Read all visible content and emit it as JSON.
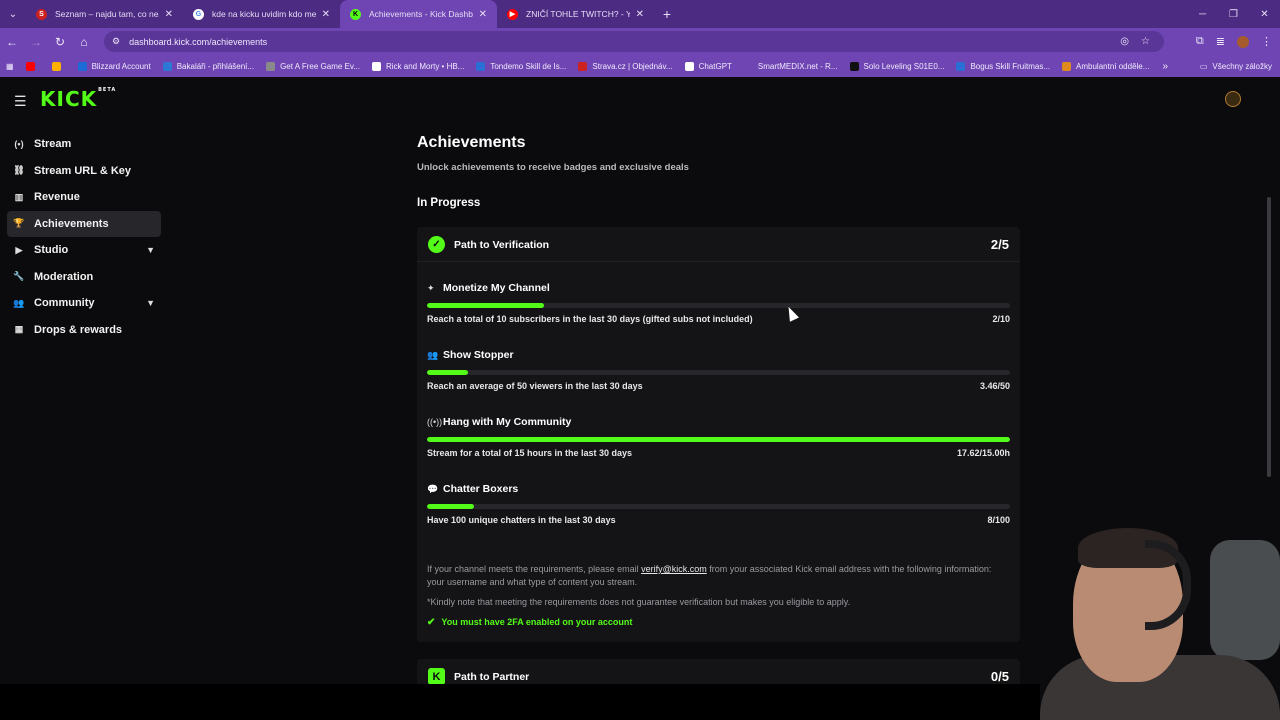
{
  "browser": {
    "tabs": [
      {
        "title": "Seznam – najdu tam, co nezná",
        "icon": "seznam",
        "color": "#cc1f1f",
        "active": false
      },
      {
        "title": "kde na kicku uvidim kdo me zn",
        "icon": "google",
        "color": "#ffffff",
        "active": false
      },
      {
        "title": "Achievements - Kick Dashboard",
        "icon": "kick",
        "color": "#53fc18",
        "active": true
      },
      {
        "title": "ZNIČÍ TOHLE TWITCH? - YouTu",
        "icon": "youtube",
        "color": "#ff0000",
        "active": false
      }
    ],
    "url": "dashboard.kick.com/achievements",
    "bookmarks": [
      {
        "label": "",
        "color": "#ff0000"
      },
      {
        "label": "",
        "color": "#ffb000"
      },
      {
        "label": "Blizzard Account",
        "color": "#1f6bd6"
      },
      {
        "label": "Bakaláři - přihlášení...",
        "color": "#2c78d4"
      },
      {
        "label": "Get A Free Game Ev...",
        "color": "#8a8a8a"
      },
      {
        "label": "Rick and Morty • HB...",
        "color": "#ffffff"
      },
      {
        "label": "Tondemo Skill de Is...",
        "color": "#2a6fd6"
      },
      {
        "label": "Strava.cz | Objednáv...",
        "color": "#cc2222"
      },
      {
        "label": "ChatGPT",
        "color": "#ffffff"
      },
      {
        "label": "SmartMEDIX.net - R...",
        "color": "#6e45b3"
      },
      {
        "label": "Solo Leveling S01E0...",
        "color": "#111111"
      },
      {
        "label": "Bogus Skill Fruitmas...",
        "color": "#2a6fd6"
      },
      {
        "label": "Ambulantní odděle...",
        "color": "#e08a1e"
      }
    ],
    "bookmarks_all": "Všechny záložky"
  },
  "logo": {
    "text": "KICK",
    "tag": "BETA"
  },
  "sidebar": {
    "items": [
      {
        "label": "Stream",
        "icon": "broadcast-icon",
        "glyph": "(•)",
        "active": false,
        "expandable": false
      },
      {
        "label": "Stream URL & Key",
        "icon": "link-icon",
        "glyph": "⛓",
        "active": false,
        "expandable": false
      },
      {
        "label": "Revenue",
        "icon": "chart-icon",
        "glyph": "▥",
        "active": false,
        "expandable": false
      },
      {
        "label": "Achievements",
        "icon": "trophy-icon",
        "glyph": "🏆",
        "active": true,
        "expandable": false
      },
      {
        "label": "Studio",
        "icon": "video-icon",
        "glyph": "▶",
        "active": false,
        "expandable": true
      },
      {
        "label": "Moderation",
        "icon": "wrench-icon",
        "glyph": "🔧",
        "active": false,
        "expandable": false
      },
      {
        "label": "Community",
        "icon": "people-icon",
        "glyph": "👥",
        "active": false,
        "expandable": true
      },
      {
        "label": "Drops & rewards",
        "icon": "gift-icon",
        "glyph": "▦",
        "active": false,
        "expandable": false
      }
    ]
  },
  "main": {
    "title": "Achievements",
    "subtitle": "Unlock achievements to receive badges and exclusive deals",
    "section": "In Progress",
    "verification": {
      "title": "Path to Verification",
      "count": "2/5",
      "achievements": [
        {
          "name": "Monetize My Channel",
          "icon": "sparkle-icon",
          "glyph": "✦",
          "desc": "Reach a total of 10 subscribers in the last 30 days (gifted subs not included)",
          "value": "2/10",
          "progress": 0.2
        },
        {
          "name": "Show Stopper",
          "icon": "viewers-icon",
          "glyph": "👥",
          "desc": "Reach an average of 50 viewers in the last 30 days",
          "value": "3.46/50",
          "progress": 0.07
        },
        {
          "name": "Hang with My Community",
          "icon": "broadcast-icon",
          "glyph": "((•))",
          "desc": "Stream for a total of 15 hours in the last 30 days",
          "value": "17.62/15.00h",
          "progress": 1.0
        },
        {
          "name": "Chatter Boxers",
          "icon": "chat-icon",
          "glyph": "💬",
          "desc": "Have 100 unique chatters in the last 30 days",
          "value": "8/100",
          "progress": 0.08
        }
      ],
      "info_before": "If your channel meets the requirements, please email ",
      "info_email": "verify@kick.com",
      "info_after": " from your associated Kick email address with the following information: your username and what type of content you stream.",
      "note": "*Kindly note that meeting the requirements does not guarantee verification but makes you eligible to apply.",
      "twofa": "You must have 2FA enabled on your account"
    },
    "partner": {
      "title": "Path to Partner",
      "count": "0/5"
    }
  }
}
